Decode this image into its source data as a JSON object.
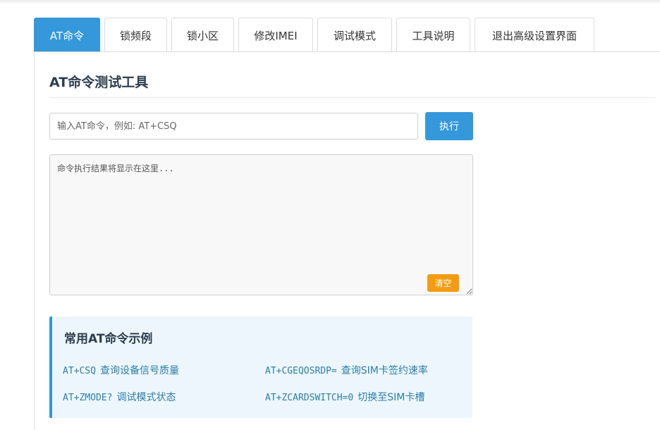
{
  "tabs": [
    {
      "label": "AT命令",
      "active": true
    },
    {
      "label": "锁频段",
      "active": false
    },
    {
      "label": "锁小区",
      "active": false
    },
    {
      "label": "修改IMEI",
      "active": false
    },
    {
      "label": "调试模式",
      "active": false
    },
    {
      "label": "工具说明",
      "active": false
    },
    {
      "label": "退出高级设置界面",
      "active": false
    }
  ],
  "panel": {
    "title": "AT命令测试工具",
    "input_placeholder": "输入AT命令，例如: AT+CSQ",
    "input_value": "",
    "execute_label": "执行",
    "result_placeholder": "命令执行结果将显示在这里...",
    "clear_label": "清空"
  },
  "examples": {
    "title": "常用AT命令示例",
    "items": [
      {
        "cmd": "AT+CSQ",
        "desc": "查询设备信号质量"
      },
      {
        "cmd": "AT+CGEQOSRDP=",
        "desc": "查询SIM卡签约速率"
      },
      {
        "cmd": "AT+ZMODE?",
        "desc": "调试模式状态"
      },
      {
        "cmd": "AT+ZCARDSWITCH=0",
        "desc": "切换至SIM卡槽"
      }
    ]
  },
  "colors": {
    "primary": "#3498db",
    "warning": "#f39c12",
    "heading": "#2c3e50",
    "example_text": "#2a7fa8",
    "example_bg": "#eef6fd"
  }
}
